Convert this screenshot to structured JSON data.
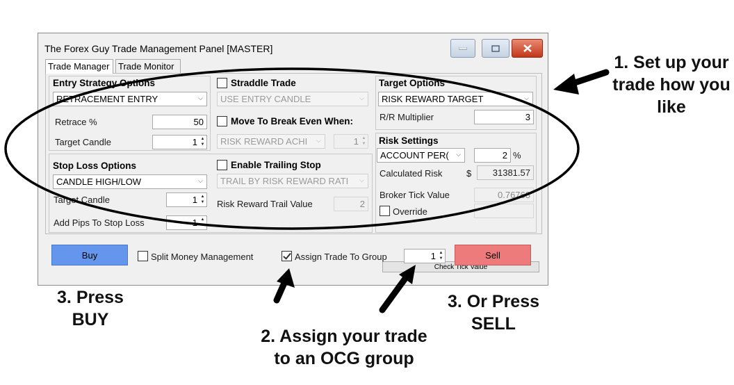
{
  "window": {
    "title": "The Forex Guy Trade Management Panel [MASTER]",
    "minimize_glyph": "—",
    "maximize_glyph": "□",
    "close_glyph": "✖",
    "icons": {
      "minimize": "minimize-icon",
      "maximize": "maximize-icon",
      "close": "close-icon"
    }
  },
  "tabs": [
    {
      "label": "Trade Manager",
      "active": true
    },
    {
      "label": "Trade Monitor",
      "active": false
    }
  ],
  "entry_strategy": {
    "title": "Entry Strategy Options",
    "entry_type": "RETRACEMENT ENTRY",
    "retrace_label": "Retrace %",
    "retrace_value": "50",
    "target_candle_label": "Target Candle",
    "target_candle_value": "1"
  },
  "straddle": {
    "label": "Straddle Trade",
    "checked": false,
    "mode": "USE ENTRY CANDLE"
  },
  "break_even": {
    "label": "Move To Break Even When:",
    "checked": false,
    "mode": "RISK REWARD ACHI",
    "value": "1"
  },
  "target_options": {
    "title": "Target Options",
    "target_type": "RISK REWARD TARGET",
    "rr_label": "R/R Multiplier",
    "rr_value": "3"
  },
  "risk_settings": {
    "title": "Risk Settings",
    "risk_type": "ACCOUNT PER(",
    "risk_percent": "2",
    "percent_sign": "%",
    "calculated_risk_label": "Calculated Risk",
    "currency_symbol": "$",
    "calculated_risk_value": "31381.57",
    "broker_tick_label": "Broker Tick Value",
    "broker_tick_value": "0.76768",
    "override_label": "Override",
    "override_checked": false,
    "check_tick_button": "Check Tick Value"
  },
  "stop_loss": {
    "title": "Stop Loss Options",
    "stop_type": "CANDLE HIGH/LOW",
    "target_candle_label": "Target Candle",
    "target_candle_value": "1",
    "add_pips_label": "Add Pips To Stop Loss",
    "add_pips_value": "1"
  },
  "trailing_stop": {
    "label": "Enable Trailing Stop",
    "checked": false,
    "mode": "TRAIL BY RISK REWARD RATI",
    "trail_value_label": "Risk Reward Trail Value",
    "trail_value": "2"
  },
  "bottom_bar": {
    "buy_label": "Buy",
    "sell_label": "Sell",
    "split_money_label": "Split Money Management",
    "split_money_checked": false,
    "assign_group_label": "Assign Trade To Group",
    "assign_group_checked": true,
    "group_value": "1"
  },
  "annotations": {
    "step1": [
      "1. Set up your",
      "trade how you",
      "like"
    ],
    "step2": [
      "2. Assign your trade",
      "to an OCG group"
    ],
    "step3_buy": [
      "3. Press",
      "BUY"
    ],
    "step3_sell": [
      "3. Or Press",
      "SELL"
    ]
  },
  "colors": {
    "buy": "#6496ee",
    "sell": "#ee7b7b",
    "close_button": "#c2371b",
    "window_bg": "#f0f0f0"
  },
  "spin_glyph": "▲▼",
  "arrow_glyph": "﹀"
}
